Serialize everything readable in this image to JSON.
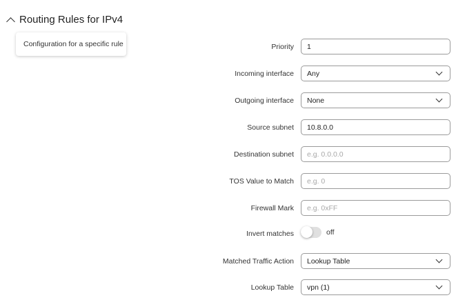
{
  "section": {
    "title": "Routing Rules for IPv4",
    "description": "Configuration for a specific rule"
  },
  "fields": {
    "priority": {
      "label": "Priority",
      "value": "1",
      "placeholder": ""
    },
    "incoming": {
      "label": "Incoming interface",
      "value": "Any"
    },
    "outgoing": {
      "label": "Outgoing interface",
      "value": "None"
    },
    "source": {
      "label": "Source subnet",
      "value": "10.8.0.0",
      "placeholder": ""
    },
    "destination": {
      "label": "Destination subnet",
      "value": "",
      "placeholder": "e.g. 0.0.0.0"
    },
    "tos": {
      "label": "TOS Value to Match",
      "value": "",
      "placeholder": "e.g. 0"
    },
    "fwmark": {
      "label": "Firewall Mark",
      "value": "",
      "placeholder": "e.g. 0xFF"
    },
    "invert": {
      "label": "Invert matches",
      "state": "off"
    },
    "action": {
      "label": "Matched Traffic Action",
      "value": "Lookup Table"
    },
    "lookup": {
      "label": "Lookup Table",
      "value": "vpn (1)"
    }
  }
}
